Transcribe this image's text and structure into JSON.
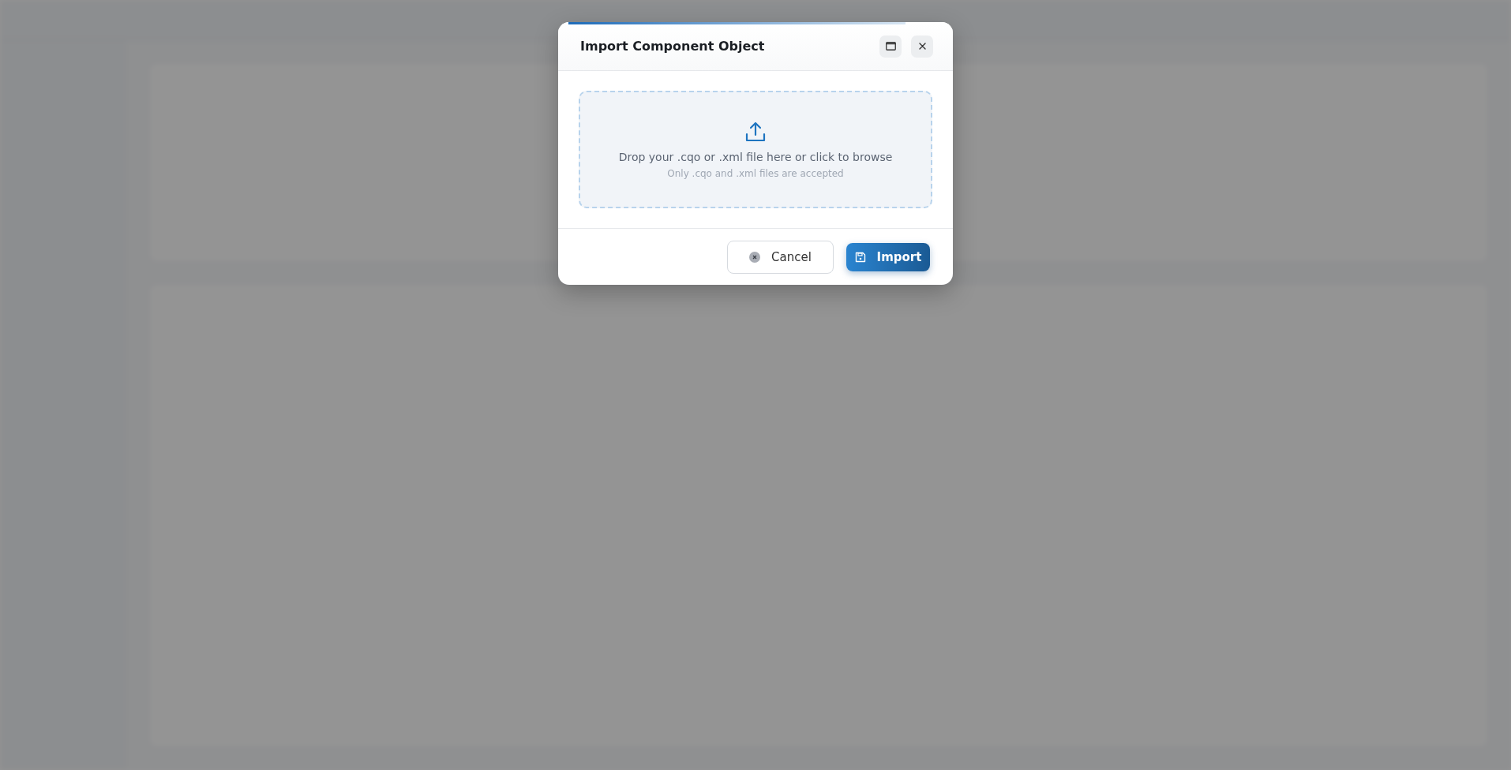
{
  "dialog": {
    "title": "Import Component Object",
    "dropzone": {
      "prompt": "Drop your .cqo or .xml file here or click to browse",
      "hint": "Only .cqo and .xml files are accepted"
    },
    "buttons": [
      {
        "kind": "secondary",
        "label": "Cancel"
      },
      {
        "kind": "primary",
        "label": "Import"
      }
    ]
  }
}
